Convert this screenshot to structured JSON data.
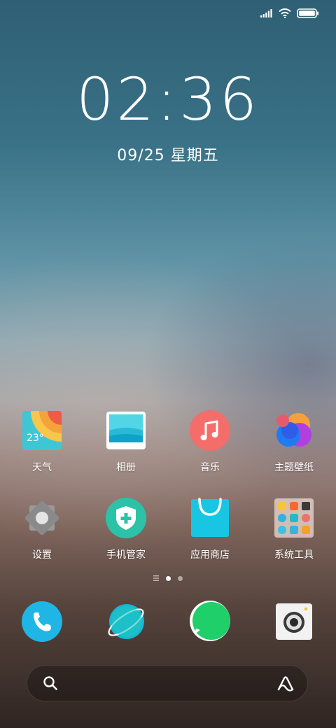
{
  "status_bar": {
    "icons": [
      "signal-icon",
      "wifi-icon",
      "battery-icon"
    ]
  },
  "clock": {
    "time": "02:36",
    "date": "09/25 星期五"
  },
  "apps": [
    {
      "id": "weather",
      "label": "天气",
      "icon": "weather-icon",
      "badge_text": "23°"
    },
    {
      "id": "gallery",
      "label": "相册",
      "icon": "gallery-icon"
    },
    {
      "id": "music",
      "label": "音乐",
      "icon": "music-icon"
    },
    {
      "id": "themes",
      "label": "主题壁纸",
      "icon": "themes-icon"
    },
    {
      "id": "settings",
      "label": "设置",
      "icon": "settings-icon"
    },
    {
      "id": "security",
      "label": "手机管家",
      "icon": "security-icon"
    },
    {
      "id": "appstore",
      "label": "应用商店",
      "icon": "app-store-icon"
    },
    {
      "id": "tools",
      "label": "系统工具",
      "icon": "system-tools-folder-icon"
    }
  ],
  "page_indicator": {
    "pages": 3,
    "active": 1
  },
  "dock": [
    {
      "id": "phone",
      "icon": "phone-icon"
    },
    {
      "id": "browser",
      "icon": "browser-icon"
    },
    {
      "id": "messages",
      "icon": "messages-icon"
    },
    {
      "id": "camera",
      "icon": "camera-icon"
    }
  ],
  "search": {
    "placeholder": "",
    "icons": [
      "search-icon",
      "assistant-icon"
    ]
  },
  "colors": {
    "weather_bg": "#3fc6d4",
    "music_bg": "#f36d6a",
    "security_bg": "#2cc2a7",
    "appstore_bg": "#18c6e3",
    "phone_bg": "#1fb6e6",
    "browser_bg": "#19b5d4",
    "messages_bg": "#1fcf6a",
    "settings_bg": "#8a8a8a"
  }
}
